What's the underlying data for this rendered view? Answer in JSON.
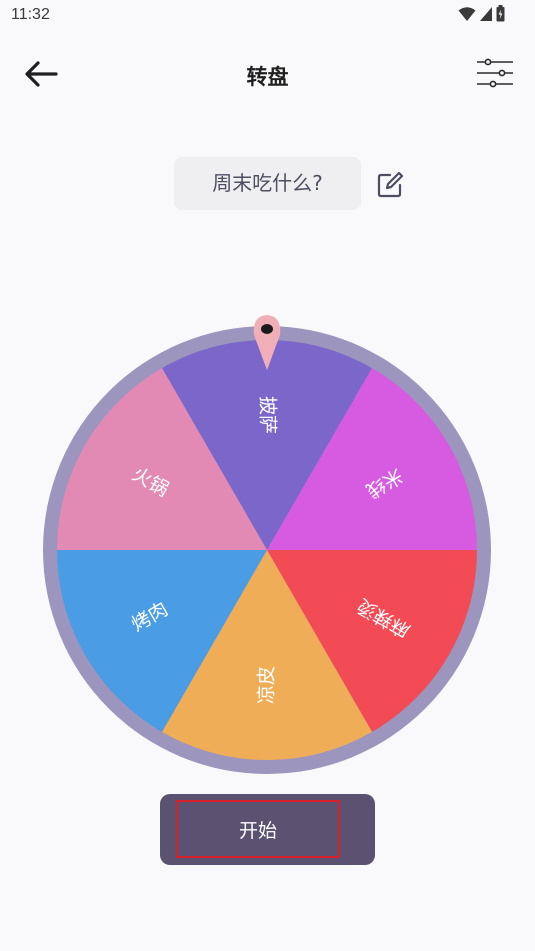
{
  "status_bar": {
    "time": "11:32",
    "icons": [
      "wifi-icon",
      "signal-icon",
      "battery-icon"
    ]
  },
  "toolbar": {
    "title": "转盘",
    "back_icon": "arrow-left-icon",
    "settings_icon": "sliders-icon"
  },
  "question": {
    "text": "周末吃什么?",
    "edit_icon": "edit-icon"
  },
  "wheel": {
    "colors": {
      "rim": "#9c95be",
      "pointer": "#f2aeb6",
      "pointer_dot": "#1a1a1a"
    },
    "segments": [
      {
        "label": "披萨",
        "color": "#7b67ca"
      },
      {
        "label": "米线",
        "color": "#d65be0"
      },
      {
        "label": "麻辣烫",
        "color": "#f24b56"
      },
      {
        "label": "凉皮",
        "color": "#f0ad58"
      },
      {
        "label": "烤肉",
        "color": "#4a9de4"
      },
      {
        "label": "火锅",
        "color": "#e38ab4"
      }
    ]
  },
  "start_button": {
    "label": "开始"
  }
}
